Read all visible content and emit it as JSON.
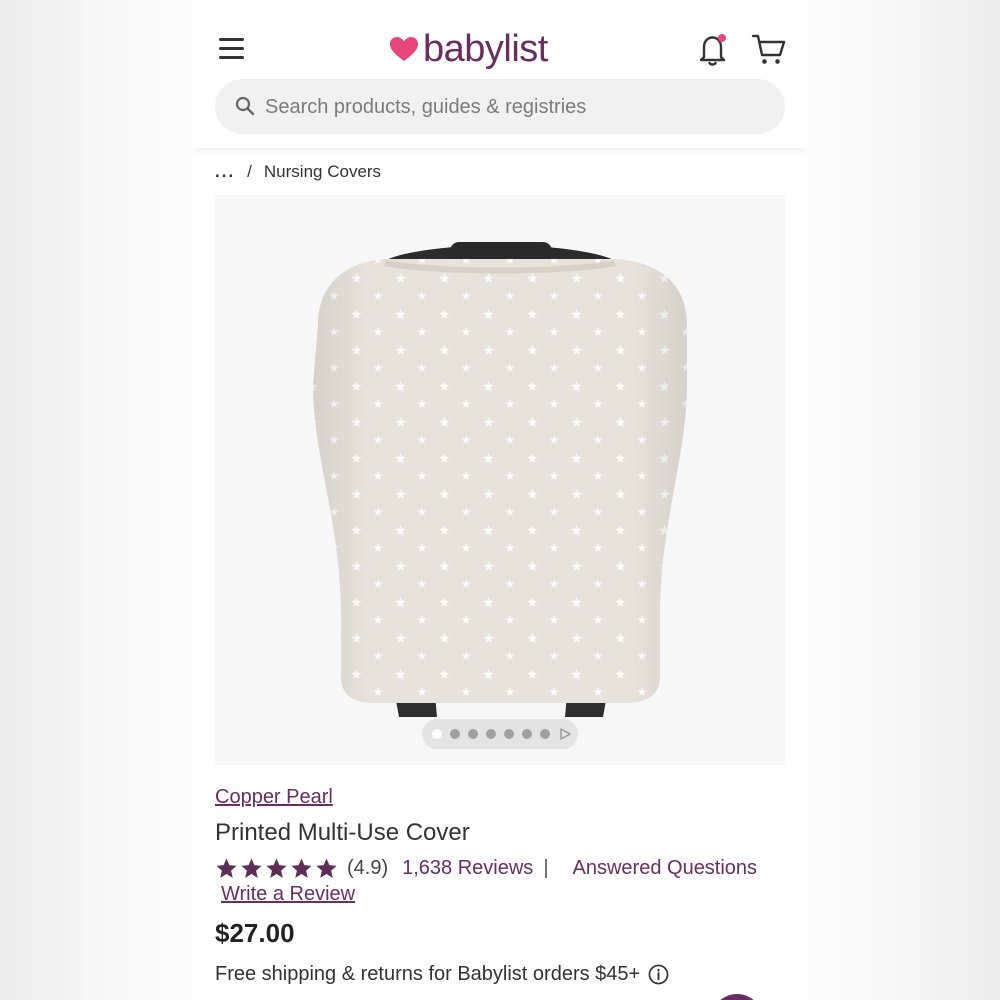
{
  "header": {
    "menu_icon": "hamburger-menu-icon",
    "logo_text": "babylist",
    "logo_icon": "heart-icon",
    "notification_icon": "bell-icon",
    "cart_icon": "cart-icon"
  },
  "search": {
    "placeholder": "Search products, guides & registries",
    "icon": "search-icon"
  },
  "breadcrumb": {
    "ellipsis": "...",
    "separator": "/",
    "current": "Nursing Covers"
  },
  "gallery": {
    "image_count": 7,
    "active_index": 0,
    "product_image": "nursing-cover-photo"
  },
  "product": {
    "brand": "Copper Pearl",
    "title": "Printed Multi-Use Cover",
    "rating": "(4.9)",
    "stars": 5,
    "reviews_label": "1,638 Reviews",
    "separator": "|",
    "questions_label": "Answered Questions",
    "write_review_label": "Write a Review",
    "price": "$27.00",
    "shipping_note": "Free shipping & returns for Babylist orders $45+"
  },
  "colors": {
    "brand_purple": "#6b2c64",
    "heart_pink": "#e8457a",
    "cover_fabric": "#e8e3da"
  }
}
